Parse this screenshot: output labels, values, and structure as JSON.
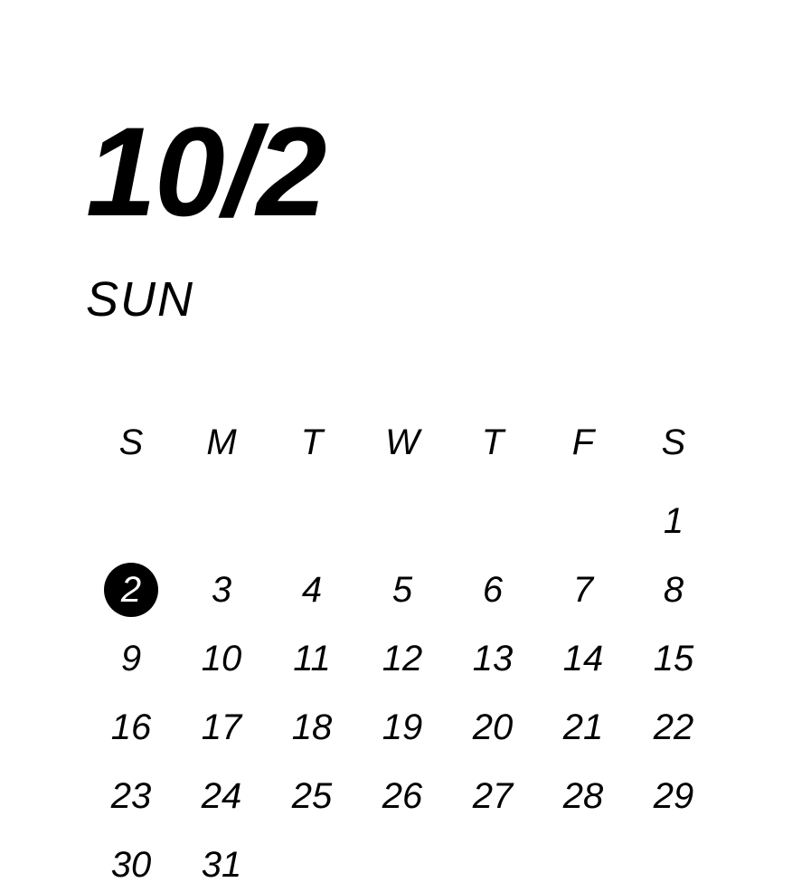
{
  "header": {
    "date_display": "10/2",
    "day_name": "SUN"
  },
  "calendar": {
    "weekday_headers": [
      "S",
      "M",
      "T",
      "W",
      "T",
      "F",
      "S"
    ],
    "month": 10,
    "selected_day": 2,
    "weeks": [
      [
        null,
        null,
        null,
        null,
        null,
        null,
        1
      ],
      [
        2,
        3,
        4,
        5,
        6,
        7,
        8
      ],
      [
        9,
        10,
        11,
        12,
        13,
        14,
        15
      ],
      [
        16,
        17,
        18,
        19,
        20,
        21,
        22
      ],
      [
        23,
        24,
        25,
        26,
        27,
        28,
        29
      ],
      [
        30,
        31,
        null,
        null,
        null,
        null,
        null
      ]
    ]
  },
  "colors": {
    "background": "#ffffff",
    "text": "#000000",
    "selected_bg": "#000000",
    "selected_fg": "#ffffff"
  }
}
